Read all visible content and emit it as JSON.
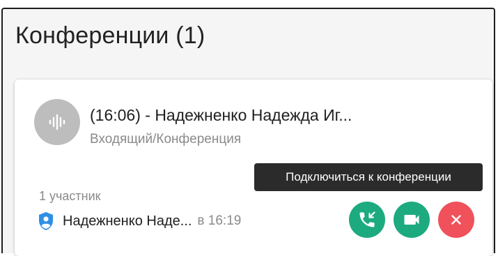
{
  "header": {
    "title": "Конференции (1)"
  },
  "call": {
    "title": "(16:06) - Надежненко Надежда Иг...",
    "subtitle": "Входящий/Конференция",
    "participants_count": "1 участник",
    "participant": {
      "name": "Надежненко Наде...",
      "time": "в 16:19"
    }
  },
  "actions": {
    "join_tooltip": "Подключиться к конференции",
    "join_icon": "phone-join-icon",
    "video_icon": "video-camera-icon",
    "decline_icon": "close-icon"
  },
  "colors": {
    "accept": "#1daa7f",
    "decline": "#f0515b",
    "shield": "#2e8fe6",
    "avatar": "#bdbdbd",
    "tooltip": "#2b2b2b"
  }
}
